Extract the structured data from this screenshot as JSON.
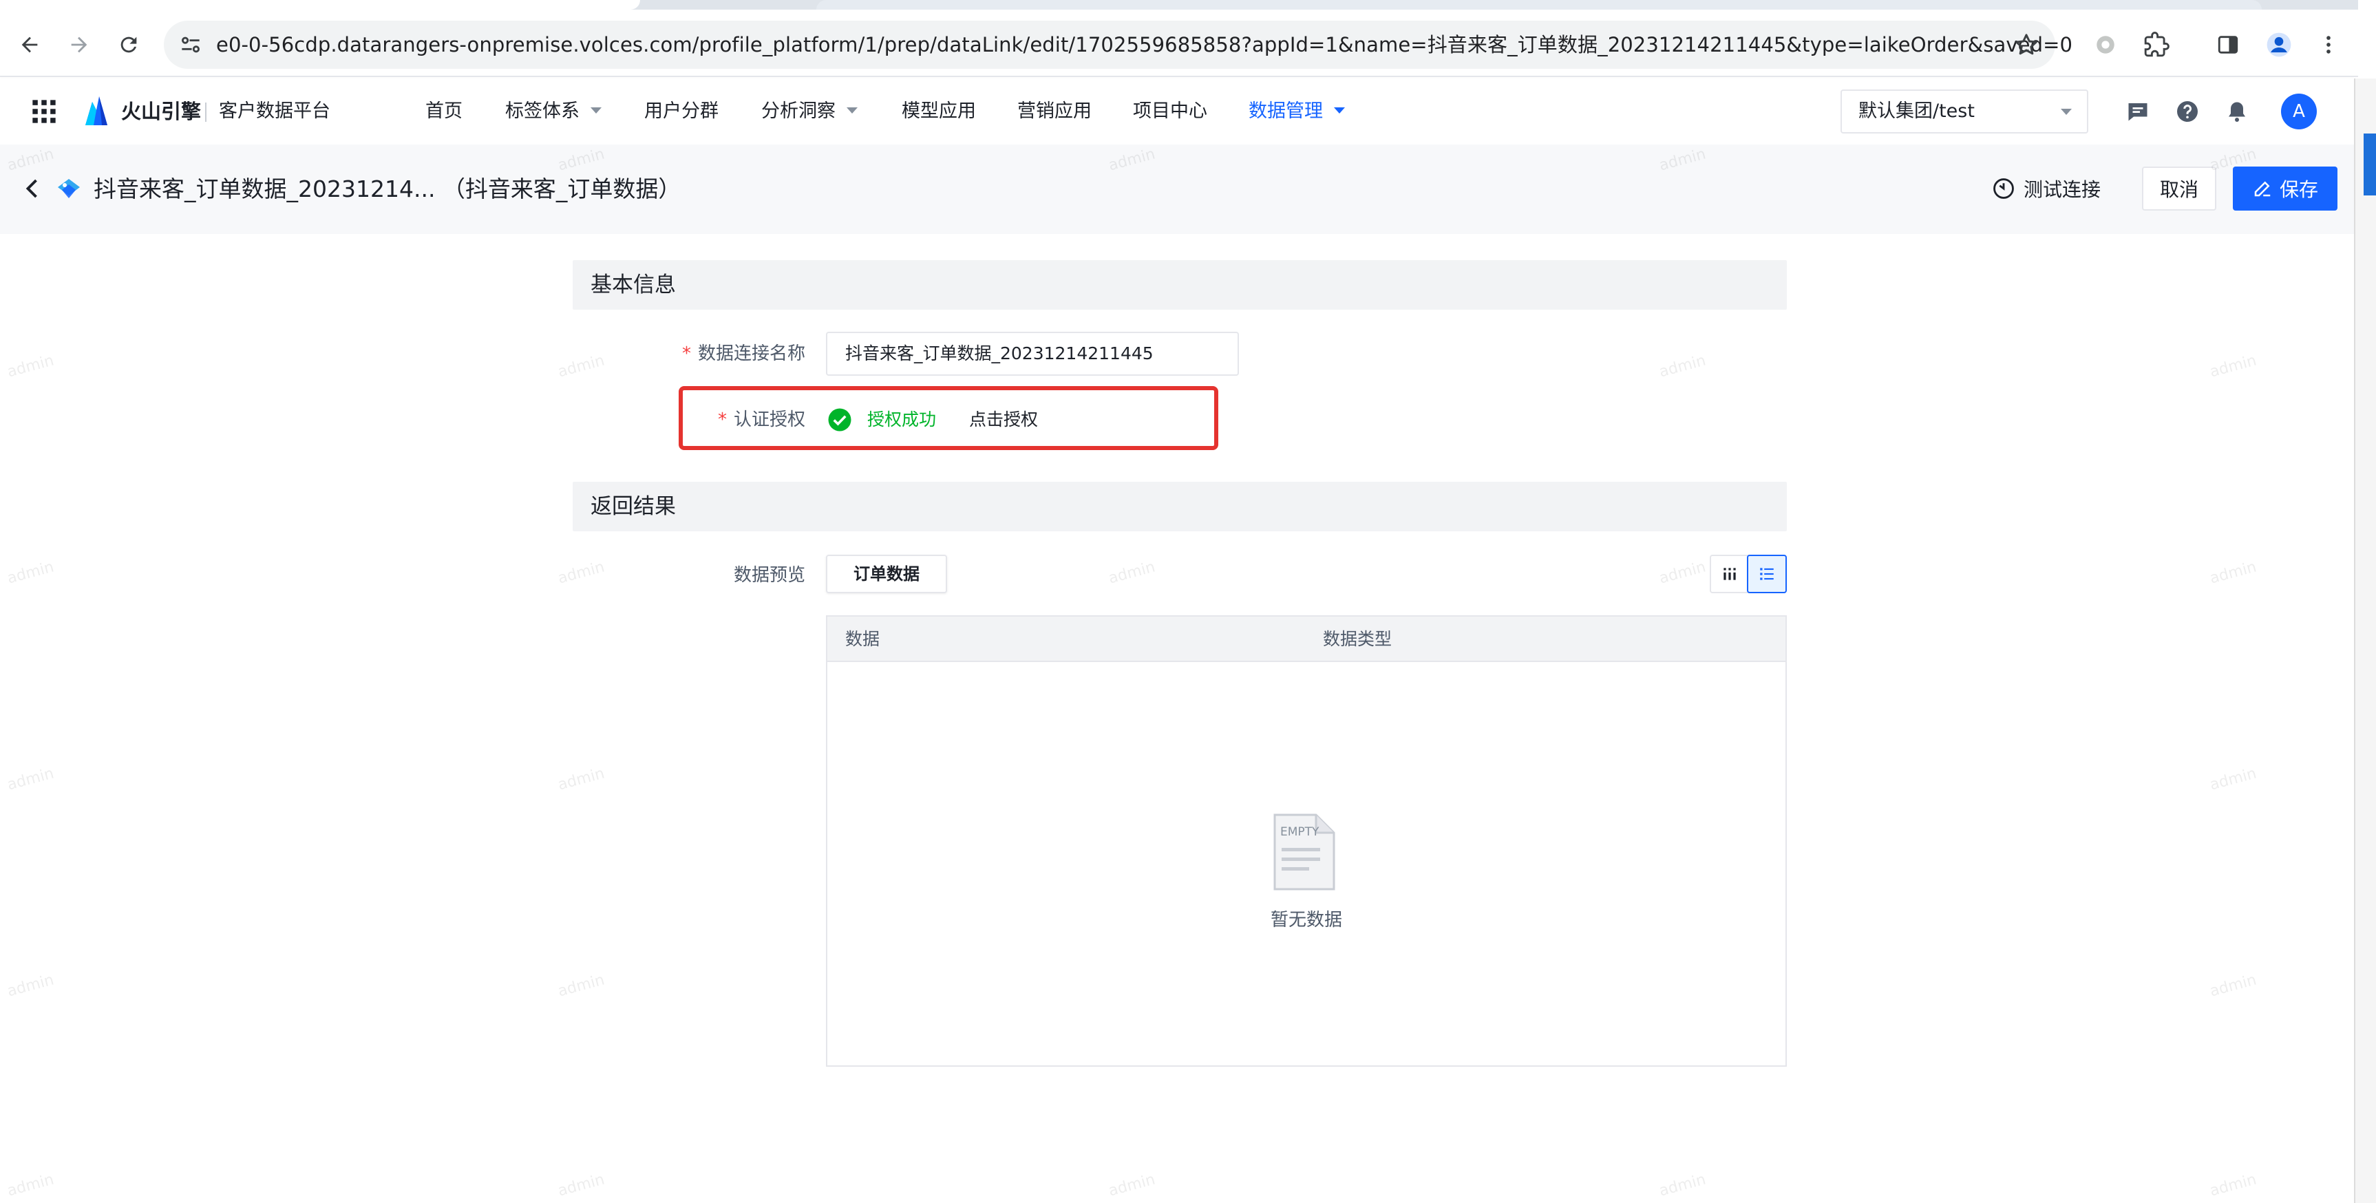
{
  "browser": {
    "url": "e0-0-56cdp.datarangers-onpremise.volces.com/profile_platform/1/prep/dataLink/edit/1702559685858?appId=1&name=抖音来客_订单数据_20231214211445&type=laikeOrder&saved=0"
  },
  "app": {
    "brand": "火山引擎",
    "product": "客户数据平台",
    "nav": [
      {
        "label": "首页",
        "dropdown": false,
        "active": false
      },
      {
        "label": "标签体系",
        "dropdown": true,
        "active": false
      },
      {
        "label": "用户分群",
        "dropdown": false,
        "active": false
      },
      {
        "label": "分析洞察",
        "dropdown": true,
        "active": false
      },
      {
        "label": "模型应用",
        "dropdown": false,
        "active": false
      },
      {
        "label": "营销应用",
        "dropdown": false,
        "active": false
      },
      {
        "label": "项目中心",
        "dropdown": false,
        "active": false
      },
      {
        "label": "数据管理",
        "dropdown": true,
        "active": true
      }
    ],
    "org_select": "默认集团/test",
    "avatar_letter": "A",
    "accent_color": "#1664ff"
  },
  "page": {
    "title": "抖音来客_订单数据_20231214...  （抖音来客_订单数据）",
    "actions": {
      "test_connection": "测试连接",
      "cancel": "取消",
      "save": "保存"
    }
  },
  "basic_info": {
    "section_title": "基本信息",
    "name_label": "数据连接名称",
    "name_value": "抖音来客_订单数据_20231214211445",
    "auth_label": "认证授权",
    "auth_status": "授权成功",
    "auth_link": "点击授权",
    "status_color": "#00b42a"
  },
  "result": {
    "section_title": "返回结果",
    "preview_label": "数据预览",
    "tabs": [
      "订单数据"
    ],
    "columns": [
      "数据",
      "数据类型"
    ],
    "empty_icon_text": "EMPTY",
    "empty_text": "暂无数据"
  },
  "watermark_text": "admin"
}
